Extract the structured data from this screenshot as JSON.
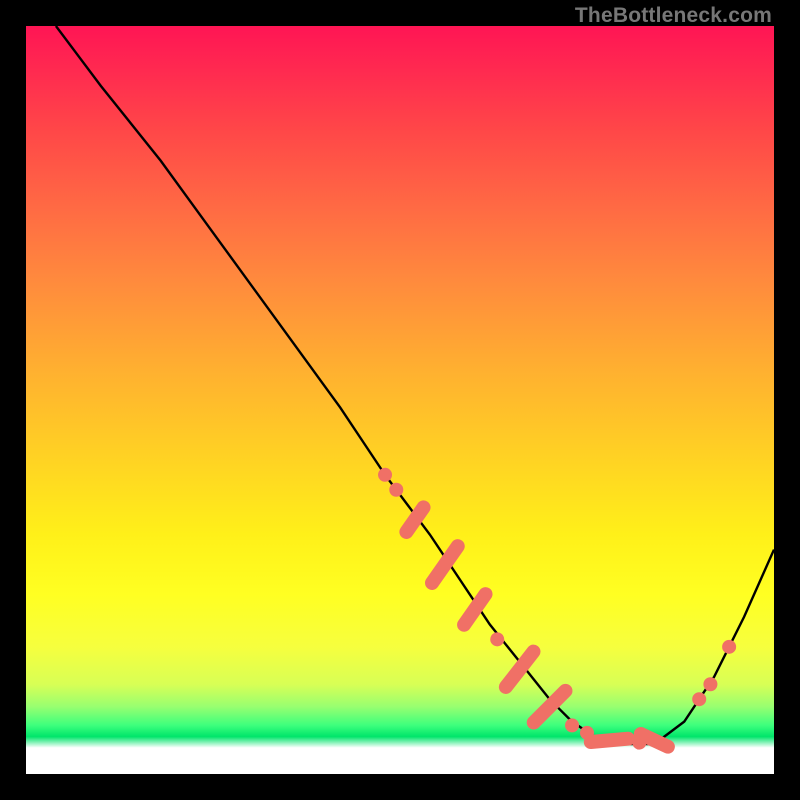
{
  "watermark": "TheBottleneck.com",
  "chart_data": {
    "type": "line",
    "title": "",
    "xlabel": "",
    "ylabel": "",
    "xlim": [
      0,
      100
    ],
    "ylim": [
      0,
      100
    ],
    "grid": false,
    "legend": false,
    "series": [
      {
        "name": "bottleneck-curve",
        "color": "#000000",
        "x": [
          4,
          10,
          18,
          26,
          34,
          42,
          48,
          54,
          58,
          62,
          66,
          70,
          73,
          76,
          80,
          84,
          88,
          92,
          96,
          100
        ],
        "y": [
          100,
          92,
          82,
          71,
          60,
          49,
          40,
          32,
          26,
          20,
          15,
          10,
          7,
          5,
          4,
          4,
          7,
          13,
          21,
          30
        ]
      }
    ],
    "annotations": {
      "comment": "salmon dots/pill markers clustered along the descending limb and rising limb of the curve",
      "marker_color": "#f07066",
      "markers": [
        {
          "x": 48,
          "y": 40,
          "kind": "dot"
        },
        {
          "x": 49.5,
          "y": 38,
          "kind": "dot"
        },
        {
          "x": 52,
          "y": 34,
          "kind": "pill",
          "angle": -55,
          "len": 4
        },
        {
          "x": 56,
          "y": 28,
          "kind": "pill",
          "angle": -55,
          "len": 6
        },
        {
          "x": 60,
          "y": 22,
          "kind": "pill",
          "angle": -55,
          "len": 5
        },
        {
          "x": 63,
          "y": 18,
          "kind": "dot"
        },
        {
          "x": 66,
          "y": 14,
          "kind": "pill",
          "angle": -52,
          "len": 6
        },
        {
          "x": 70,
          "y": 9,
          "kind": "pill",
          "angle": -45,
          "len": 6
        },
        {
          "x": 73,
          "y": 6.5,
          "kind": "dot"
        },
        {
          "x": 75,
          "y": 5.5,
          "kind": "dot"
        },
        {
          "x": 78,
          "y": 4.5,
          "kind": "pill",
          "angle": -5,
          "len": 5
        },
        {
          "x": 82,
          "y": 4.2,
          "kind": "dot"
        },
        {
          "x": 84,
          "y": 4.5,
          "kind": "pill",
          "angle": 25,
          "len": 4
        },
        {
          "x": 90,
          "y": 10,
          "kind": "dot"
        },
        {
          "x": 91.5,
          "y": 12,
          "kind": "dot"
        },
        {
          "x": 94,
          "y": 17,
          "kind": "dot"
        }
      ]
    }
  }
}
